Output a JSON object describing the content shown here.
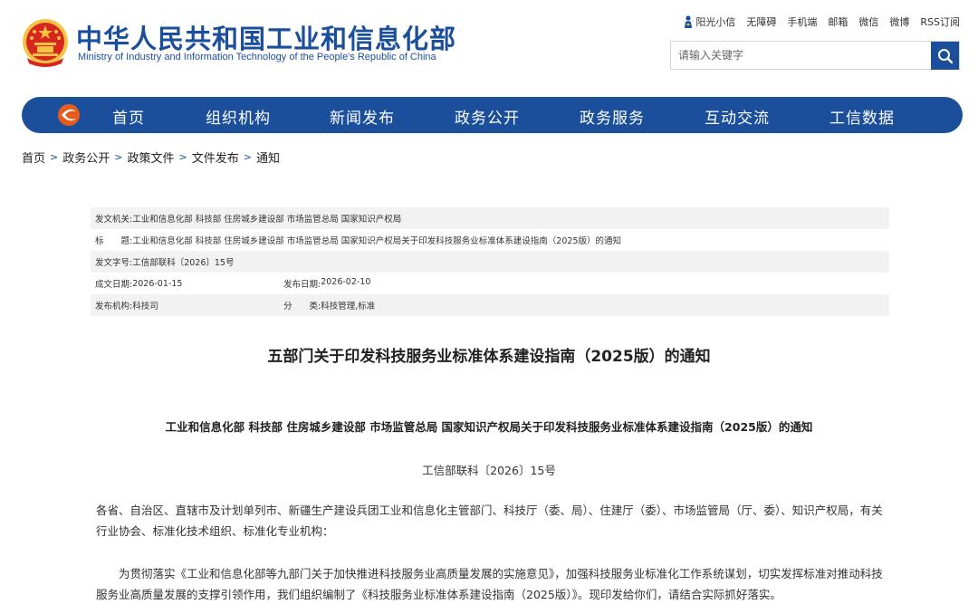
{
  "header": {
    "title_cn": "中华人民共和国工业和信息化部",
    "title_en": "Ministry of Industry and Information Technology of the People's Republic of China",
    "emblem_icon": "national-emblem-icon"
  },
  "toplinks": [
    "阳光小信",
    "无障碍",
    "手机端",
    "邮箱",
    "微信",
    "微博",
    "RSS订阅"
  ],
  "search": {
    "placeholder": "请输入关键字",
    "value": ""
  },
  "nav": {
    "logo_icon": "miit-logo-icon",
    "items": [
      "首页",
      "组织机构",
      "新闻发布",
      "政务公开",
      "政务服务",
      "互动交流",
      "工信数据"
    ]
  },
  "breadcrumb": [
    "首页",
    "政务公开",
    "政策文件",
    "文件发布",
    "通知"
  ],
  "breadcrumb_sep": ">",
  "meta": {
    "issuer_label": "发文机关:",
    "issuer": "工业和信息化部 科技部 住房城乡建设部 市场监管总局 国家知识产权局",
    "title_label": "标　　题:",
    "title": "工业和信息化部 科技部 住房城乡建设部 市场监管总局 国家知识产权局关于印发科技服务业标准体系建设指南（2025版）的通知",
    "docno_label": "发文字号:",
    "docno": "工信部联科〔2026〕15号",
    "created_label": "成文日期:",
    "created": "2026-01-15",
    "published_label": "发布日期:",
    "published": "2026-02-10",
    "org_label": "发布机构:",
    "org": "科技司",
    "category_label": "分　　类:",
    "category": "科技管理,标准"
  },
  "article": {
    "title": "五部门关于印发科技服务业标准体系建设指南（2025版）的通知",
    "subtitle": "工业和信息化部 科技部 住房城乡建设部 市场监管总局 国家知识产权局关于印发科技服务业标准体系建设指南（2025版）的通知",
    "docno": "工信部联科〔2026〕15号",
    "para1": "各省、自治区、直辖市及计划单列市、新疆生产建设兵团工业和信息化主管部门、科技厅（委、局）、住建厅（委）、市场监管局（厅、委）、知识产权局，有关行业协会、标准化技术组织、标准化专业机构：",
    "para2": "为贯彻落实《工业和信息化部等九部门关于加快推进科技服务业高质量发展的实施意见》，加强科技服务业标准化工作系统谋划，切实发挥标准对推动科技服务业高质量发展的支撑引领作用，我们组织编制了《科技服务业标准体系建设指南（2025版）》。现印发给你们，请结合实际抓好落实。"
  },
  "colors": {
    "brand_blue": "#1b4f9c",
    "emblem_red": "#d7261f",
    "emblem_gold": "#f6c343"
  }
}
